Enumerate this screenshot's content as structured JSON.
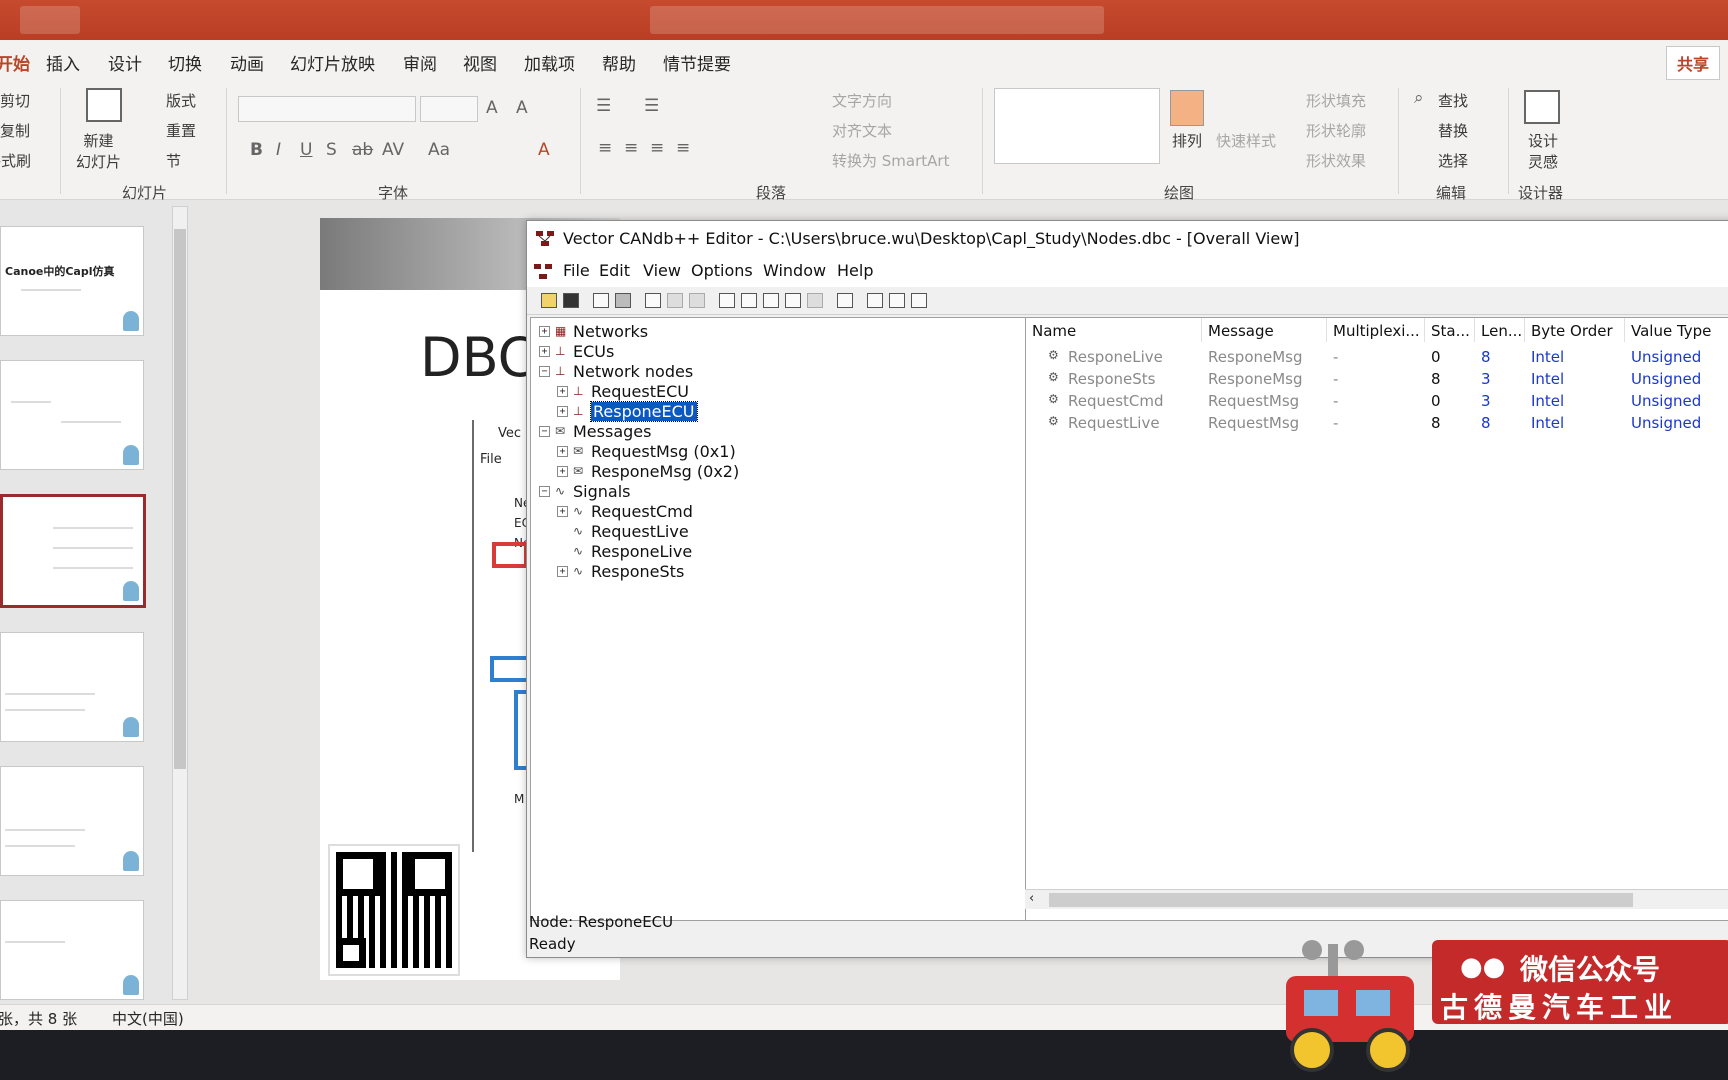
{
  "ppt": {
    "tabs": [
      "开始",
      "插入",
      "设计",
      "切换",
      "动画",
      "幻灯片放映",
      "审阅",
      "视图",
      "加载项",
      "帮助",
      "情节提要"
    ],
    "share": "共享",
    "clipboard": [
      "剪切",
      "复制",
      "格式刷"
    ],
    "slides_group": {
      "new_slide": "新建\n幻灯片",
      "layout": "版式",
      "reset": "重置",
      "section": "节",
      "label": "幻灯片"
    },
    "font_group": "字体",
    "paragraph": {
      "label": "段落",
      "text_direction": "文字方向",
      "align_text": "对齐文本",
      "smartart": "转换为 SmartArt"
    },
    "drawing": {
      "label": "绘图",
      "arrange": "排列",
      "quick_styles": "快速样式",
      "shape_fill": "形状填充",
      "shape_outline": "形状轮廓",
      "shape_effects": "形状效果"
    },
    "editing": {
      "label": "编辑",
      "find": "查找",
      "replace": "替换",
      "select": "选择"
    },
    "designer": {
      "label": "设计器",
      "ideas": "设计\n灵感"
    },
    "status": {
      "slide_count": "张，共 8 张",
      "language": "中文(中国)"
    },
    "slide_title_partial": "DBC",
    "thumb1_title": "Canoe中的Capl仿真",
    "mini_labels": [
      "Vec",
      "File",
      "Ne",
      "EC",
      "Ne",
      "M"
    ]
  },
  "editor": {
    "title": "Vector CANdb++ Editor - C:\\Users\\bruce.wu\\Desktop\\Capl_Study\\Nodes.dbc - [Overall View]",
    "menu": [
      "File",
      "Edit",
      "View",
      "Options",
      "Window",
      "Help"
    ],
    "tree": [
      {
        "label": "Networks",
        "level": 0,
        "expander": "+",
        "icon": "networks-icon"
      },
      {
        "label": "ECUs",
        "level": 0,
        "expander": "+",
        "icon": "ecu-icon"
      },
      {
        "label": "Network nodes",
        "level": 0,
        "expander": "-",
        "icon": "node-icon"
      },
      {
        "label": "RequestECU",
        "level": 1,
        "expander": "+",
        "icon": "node-icon"
      },
      {
        "label": "ResponeECU",
        "level": 1,
        "expander": "+",
        "icon": "node-icon",
        "selected": true
      },
      {
        "label": "Messages",
        "level": 0,
        "expander": "-",
        "icon": "message-icon"
      },
      {
        "label": "RequestMsg (0x1)",
        "level": 1,
        "expander": "+",
        "icon": "message-icon"
      },
      {
        "label": "ResponeMsg (0x2)",
        "level": 1,
        "expander": "+",
        "icon": "message-icon"
      },
      {
        "label": "Signals",
        "level": 0,
        "expander": "-",
        "icon": "signal-icon"
      },
      {
        "label": "RequestCmd",
        "level": 1,
        "expander": "+",
        "icon": "signal-icon"
      },
      {
        "label": "RequestLive",
        "level": 1,
        "expander": "",
        "icon": "signal-icon"
      },
      {
        "label": "ResponeLive",
        "level": 1,
        "expander": "",
        "icon": "signal-icon"
      },
      {
        "label": "ResponeSts",
        "level": 1,
        "expander": "+",
        "icon": "signal-icon"
      }
    ],
    "columns": [
      "Name",
      "Message",
      "Multiplexi...",
      "Sta...",
      "Len...",
      "Byte Order",
      "Value Type"
    ],
    "rows": [
      {
        "name": "ResponeLive",
        "message": "ResponeMsg",
        "mux": "-",
        "start": "0",
        "len": "8",
        "order": "Intel",
        "type": "Unsigned"
      },
      {
        "name": "ResponeSts",
        "message": "ResponeMsg",
        "mux": "-",
        "start": "8",
        "len": "3",
        "order": "Intel",
        "type": "Unsigned"
      },
      {
        "name": "RequestCmd",
        "message": "RequestMsg",
        "mux": "-",
        "start": "0",
        "len": "3",
        "order": "Intel",
        "type": "Unsigned"
      },
      {
        "name": "RequestLive",
        "message": "RequestMsg",
        "mux": "-",
        "start": "8",
        "len": "8",
        "order": "Intel",
        "type": "Unsigned"
      }
    ],
    "status_node": "Node: ResponeECU",
    "status_ready": "Ready"
  },
  "watermark": {
    "line1": "微信公众号",
    "line2": "古德曼汽车工业"
  },
  "colors": {
    "ppt_accent": "#b7472a",
    "selection": "#0a58c2",
    "value_blue": "#1a38c9",
    "watermark_red": "#c42a2a"
  }
}
